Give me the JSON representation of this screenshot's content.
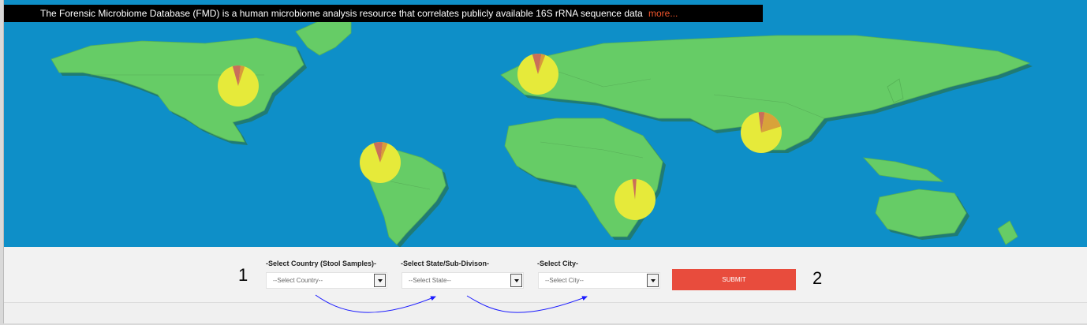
{
  "intro": {
    "text": "The Forensic Microbiome Database (FMD) is a human microbiome analysis resource that correlates publicly available 16S rRNA sequence data",
    "more_link": "more..."
  },
  "map": {
    "ocean_color": "#0e8fc8",
    "land_color": "#66cc66",
    "pie_base_color": "#e6ea3a",
    "pie_markers": [
      {
        "region": "North America"
      },
      {
        "region": "Europe"
      },
      {
        "region": "South America"
      },
      {
        "region": "Africa"
      },
      {
        "region": "South Asia"
      }
    ]
  },
  "filters": {
    "country": {
      "label": "-Select Country (Stool Samples)-",
      "value": "--Select Country--"
    },
    "state": {
      "label": "-Select State/Sub-Divison-",
      "value": "--Select State--"
    },
    "city": {
      "label": "-Select City-",
      "value": "--Select City--"
    }
  },
  "submit_label": "SUBMIT",
  "steps": {
    "first": "1",
    "second": "2"
  },
  "colors": {
    "submit": "#e84c3d",
    "arrows": "#1a1aff"
  }
}
